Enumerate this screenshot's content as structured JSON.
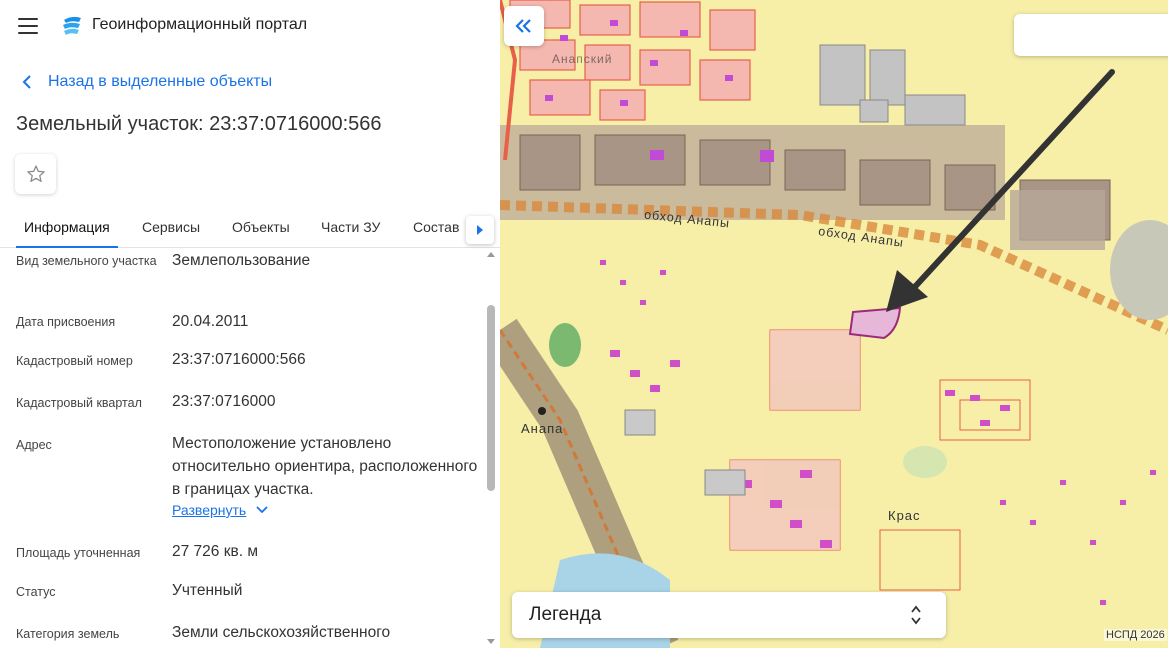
{
  "header": {
    "app_title": "Геоинформационный портал"
  },
  "nav": {
    "back_label": "Назад в выделенные объекты"
  },
  "object": {
    "title": "Земельный участок: 23:37:0716000:566"
  },
  "tabs": [
    {
      "label": "Информация",
      "active": true
    },
    {
      "label": "Сервисы",
      "active": false
    },
    {
      "label": "Объекты",
      "active": false
    },
    {
      "label": "Части ЗУ",
      "active": false
    },
    {
      "label": "Состав",
      "active": false
    }
  ],
  "properties": [
    {
      "label": "Вид земельного участка",
      "value": "Землепользование"
    },
    {
      "label": "Дата присвоения",
      "value": "20.04.2011"
    },
    {
      "label": "Кадастровый номер",
      "value": "23:37:0716000:566"
    },
    {
      "label": "Кадастровый квартал",
      "value": "23:37:0716000"
    },
    {
      "label": "Адрес",
      "value": "Местоположение установлено относительно ориентира, расположенного в границах участка."
    },
    {
      "label": "Площадь уточненная",
      "value": "27 726 кв. м"
    },
    {
      "label": "Статус",
      "value": "Учтенный"
    },
    {
      "label": "Категория земель",
      "value": "Земли сельскохозяйственного"
    }
  ],
  "address_expand_label": "Развернуть",
  "map": {
    "labels": {
      "road1": "обход Анапы",
      "road2": "обход Анапы",
      "station": "Анапа",
      "district": "Крас",
      "top_label": "Анапский"
    },
    "legend_label": "Легенда",
    "copyright": "НСПД 2026",
    "search_placeholder": ""
  },
  "colors": {
    "accent": "#1a73e8",
    "map_base": "#f7efa8",
    "parcel_outline": "#e8604a",
    "building": "#c060d0",
    "selected_parcel": "#9b2a7a",
    "industrial": "#b3a395",
    "road": "#e38b3a"
  },
  "icons": {
    "menu": "hamburger-icon",
    "logo": "portal-logo-icon",
    "back": "chevron-left-icon",
    "favorite": "star-icon",
    "tab_next": "chevron-right-icon",
    "expand": "chevron-down-icon",
    "collapse_panel": "double-chevron-left-icon",
    "legend_sort": "sort-arrows-icon"
  }
}
